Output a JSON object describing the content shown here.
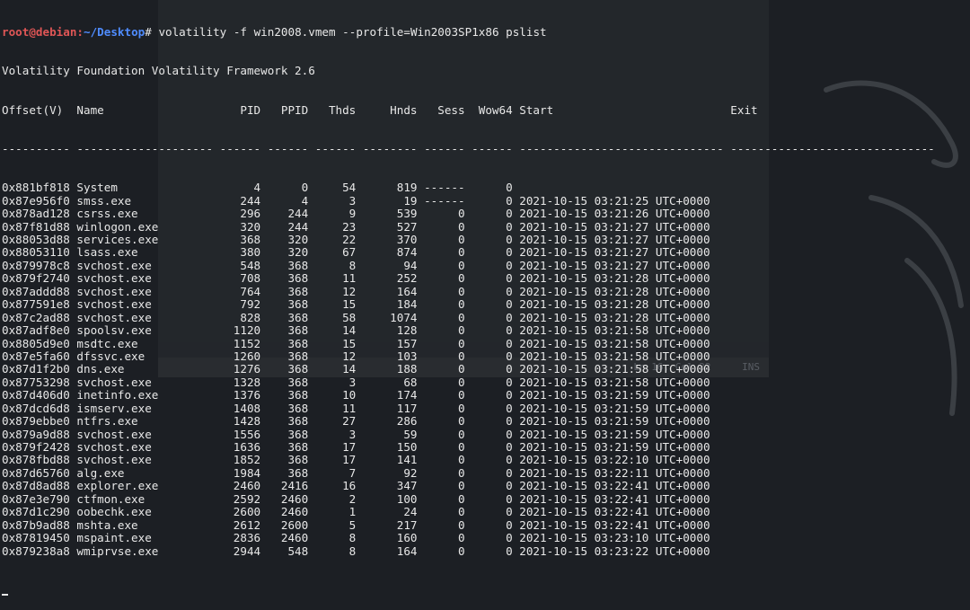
{
  "background_window": {
    "status_position": "Ln 16, Col 32",
    "status_mode": "INS"
  },
  "terminal": {
    "prompt_user_host": "root@debian",
    "prompt_sep": ":",
    "prompt_path": "~/Desktop",
    "prompt_symbol": "#",
    "command": "volatility -f win2008.vmem --profile=Win2003SP1x86 pslist",
    "banner": "Volatility Foundation Volatility Framework 2.6",
    "columns": [
      "Offset(V)",
      "Name",
      "PID",
      "PPID",
      "Thds",
      "Hnds",
      "Sess",
      "Wow64",
      "Start",
      "Exit"
    ],
    "separator": "---------- -------------------- ------ ------ ------ -------- ------ ------ ------------------------------ ------------------------------",
    "rows": [
      [
        "0x881bf818",
        "System",
        "4",
        "0",
        "54",
        "819",
        "------",
        "0",
        "",
        ""
      ],
      [
        "0x87e956f0",
        "smss.exe",
        "244",
        "4",
        "3",
        "19",
        "------",
        "0",
        "2021-10-15 03:21:25 UTC+0000",
        ""
      ],
      [
        "0x878ad128",
        "csrss.exe",
        "296",
        "244",
        "9",
        "539",
        "0",
        "0",
        "2021-10-15 03:21:26 UTC+0000",
        ""
      ],
      [
        "0x87f81d88",
        "winlogon.exe",
        "320",
        "244",
        "23",
        "527",
        "0",
        "0",
        "2021-10-15 03:21:27 UTC+0000",
        ""
      ],
      [
        "0x88053d88",
        "services.exe",
        "368",
        "320",
        "22",
        "370",
        "0",
        "0",
        "2021-10-15 03:21:27 UTC+0000",
        ""
      ],
      [
        "0x88053110",
        "lsass.exe",
        "380",
        "320",
        "67",
        "874",
        "0",
        "0",
        "2021-10-15 03:21:27 UTC+0000",
        ""
      ],
      [
        "0x879978c8",
        "svchost.exe",
        "548",
        "368",
        "8",
        "94",
        "0",
        "0",
        "2021-10-15 03:21:27 UTC+0000",
        ""
      ],
      [
        "0x879f2740",
        "svchost.exe",
        "708",
        "368",
        "11",
        "252",
        "0",
        "0",
        "2021-10-15 03:21:28 UTC+0000",
        ""
      ],
      [
        "0x87addd88",
        "svchost.exe",
        "764",
        "368",
        "12",
        "164",
        "0",
        "0",
        "2021-10-15 03:21:28 UTC+0000",
        ""
      ],
      [
        "0x877591e8",
        "svchost.exe",
        "792",
        "368",
        "15",
        "184",
        "0",
        "0",
        "2021-10-15 03:21:28 UTC+0000",
        ""
      ],
      [
        "0x87c2ad88",
        "svchost.exe",
        "828",
        "368",
        "58",
        "1074",
        "0",
        "0",
        "2021-10-15 03:21:28 UTC+0000",
        ""
      ],
      [
        "0x87adf8e0",
        "spoolsv.exe",
        "1120",
        "368",
        "14",
        "128",
        "0",
        "0",
        "2021-10-15 03:21:58 UTC+0000",
        ""
      ],
      [
        "0x8805d9e0",
        "msdtc.exe",
        "1152",
        "368",
        "15",
        "157",
        "0",
        "0",
        "2021-10-15 03:21:58 UTC+0000",
        ""
      ],
      [
        "0x87e5fa60",
        "dfssvc.exe",
        "1260",
        "368",
        "12",
        "103",
        "0",
        "0",
        "2021-10-15 03:21:58 UTC+0000",
        ""
      ],
      [
        "0x87d1f2b0",
        "dns.exe",
        "1276",
        "368",
        "14",
        "188",
        "0",
        "0",
        "2021-10-15 03:21:58 UTC+0000",
        ""
      ],
      [
        "0x87753298",
        "svchost.exe",
        "1328",
        "368",
        "3",
        "68",
        "0",
        "0",
        "2021-10-15 03:21:58 UTC+0000",
        ""
      ],
      [
        "0x87d406d0",
        "inetinfo.exe",
        "1376",
        "368",
        "10",
        "174",
        "0",
        "0",
        "2021-10-15 03:21:59 UTC+0000",
        ""
      ],
      [
        "0x87dcd6d8",
        "ismserv.exe",
        "1408",
        "368",
        "11",
        "117",
        "0",
        "0",
        "2021-10-15 03:21:59 UTC+0000",
        ""
      ],
      [
        "0x879ebbe0",
        "ntfrs.exe",
        "1428",
        "368",
        "27",
        "286",
        "0",
        "0",
        "2021-10-15 03:21:59 UTC+0000",
        ""
      ],
      [
        "0x879a9d88",
        "svchost.exe",
        "1556",
        "368",
        "3",
        "59",
        "0",
        "0",
        "2021-10-15 03:21:59 UTC+0000",
        ""
      ],
      [
        "0x879f2428",
        "svchost.exe",
        "1636",
        "368",
        "17",
        "150",
        "0",
        "0",
        "2021-10-15 03:21:59 UTC+0000",
        ""
      ],
      [
        "0x878fbd88",
        "svchost.exe",
        "1852",
        "368",
        "17",
        "141",
        "0",
        "0",
        "2021-10-15 03:22:10 UTC+0000",
        ""
      ],
      [
        "0x87d65760",
        "alg.exe",
        "1984",
        "368",
        "7",
        "92",
        "0",
        "0",
        "2021-10-15 03:22:11 UTC+0000",
        ""
      ],
      [
        "0x87d8ad88",
        "explorer.exe",
        "2460",
        "2416",
        "16",
        "347",
        "0",
        "0",
        "2021-10-15 03:22:41 UTC+0000",
        ""
      ],
      [
        "0x87e3e790",
        "ctfmon.exe",
        "2592",
        "2460",
        "2",
        "100",
        "0",
        "0",
        "2021-10-15 03:22:41 UTC+0000",
        ""
      ],
      [
        "0x87d1c290",
        "oobechk.exe",
        "2600",
        "2460",
        "1",
        "24",
        "0",
        "0",
        "2021-10-15 03:22:41 UTC+0000",
        ""
      ],
      [
        "0x87b9ad88",
        "mshta.exe",
        "2612",
        "2600",
        "5",
        "217",
        "0",
        "0",
        "2021-10-15 03:22:41 UTC+0000",
        ""
      ],
      [
        "0x87819450",
        "mspaint.exe",
        "2836",
        "2460",
        "8",
        "160",
        "0",
        "0",
        "2021-10-15 03:23:10 UTC+0000",
        ""
      ],
      [
        "0x879238a8",
        "wmiprvse.exe",
        "2944",
        "548",
        "8",
        "164",
        "0",
        "0",
        "2021-10-15 03:23:22 UTC+0000",
        ""
      ]
    ]
  }
}
